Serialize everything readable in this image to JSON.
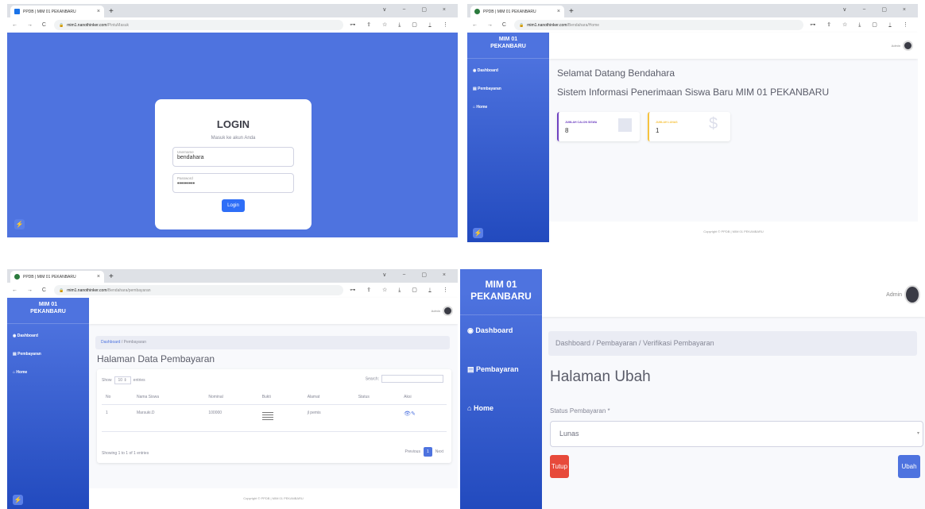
{
  "tab_title": "PPDB | MIM 01 PEKANBARU",
  "tab_close": "×",
  "tab_new": "+",
  "window_controls": "∨ − ▢ ×",
  "nav_buttons": "← → C",
  "tool_icons": "⊶ ⇪ ☆ ⤓ ▢ ⍊ ⋮",
  "lock": "🔒",
  "host": "mim1.nanothinker.com",
  "panel1": {
    "url_path": "/PintuMasuk",
    "login_title": "LOGIN",
    "login_subtitle": "Masuk ke akun Anda",
    "username_label": "Username",
    "username_value": "bendahara",
    "password_label": "Password",
    "password_value": "•••••••••",
    "login_button": "Login"
  },
  "brand": {
    "line1": "MIM 01",
    "line2": "PEKANBARU"
  },
  "menu": {
    "dashboard": "Dashboard",
    "pembayaran": "Pembayaran",
    "home": "Home"
  },
  "user_name": "Admin",
  "footer": "Copyright © PPDB | MIM 01 PEKANBARU",
  "panel2": {
    "url_path": "/Bendahara/Home",
    "welcome": "Selamat Datang Bendahara",
    "system_title": "Sistem Informasi Penerimaan Siswa Baru MIM 01 PEKANBARU",
    "cards": [
      {
        "label": "JUMLAH CALON SISWA",
        "value": "8",
        "color": "#6f42c1"
      },
      {
        "label": "JUMLAH LUNAS",
        "value": "1",
        "color": "#f6c23e"
      }
    ]
  },
  "panel3": {
    "url_path": "/Bendahara/pembayaran",
    "breadcrumb_link": "Dashboard",
    "breadcrumb_sep": "/",
    "breadcrumb_current": "Pembayaran",
    "page_title": "Halaman Data Pembayaran",
    "show_label": "Show",
    "show_value": "10",
    "entries_label": "entries",
    "search_label": "Search:",
    "columns": [
      "No",
      "Nama Siswa",
      "Nominal",
      "Bukti",
      "Alamat",
      "Status",
      "Aksi"
    ],
    "rows": [
      {
        "no": "1",
        "nama": "Marsuki.D",
        "nominal": "100000",
        "alamat": "jl pemis",
        "status": "",
        "aksi": "👁✎"
      }
    ],
    "info": "Showing 1 to 1 of 1 entries",
    "prev": "Previous",
    "page": "1",
    "next": "Next"
  },
  "panel4": {
    "breadcrumb": "Dashboard / Pembayaran / Verifikasi Pembayaran",
    "page_title": "Halaman Ubah",
    "field_label": "Status Pembayaran *",
    "field_value": "Lunas",
    "field_arrow": "▾",
    "close_button": "Tutup",
    "submit_button": "Ubah"
  }
}
